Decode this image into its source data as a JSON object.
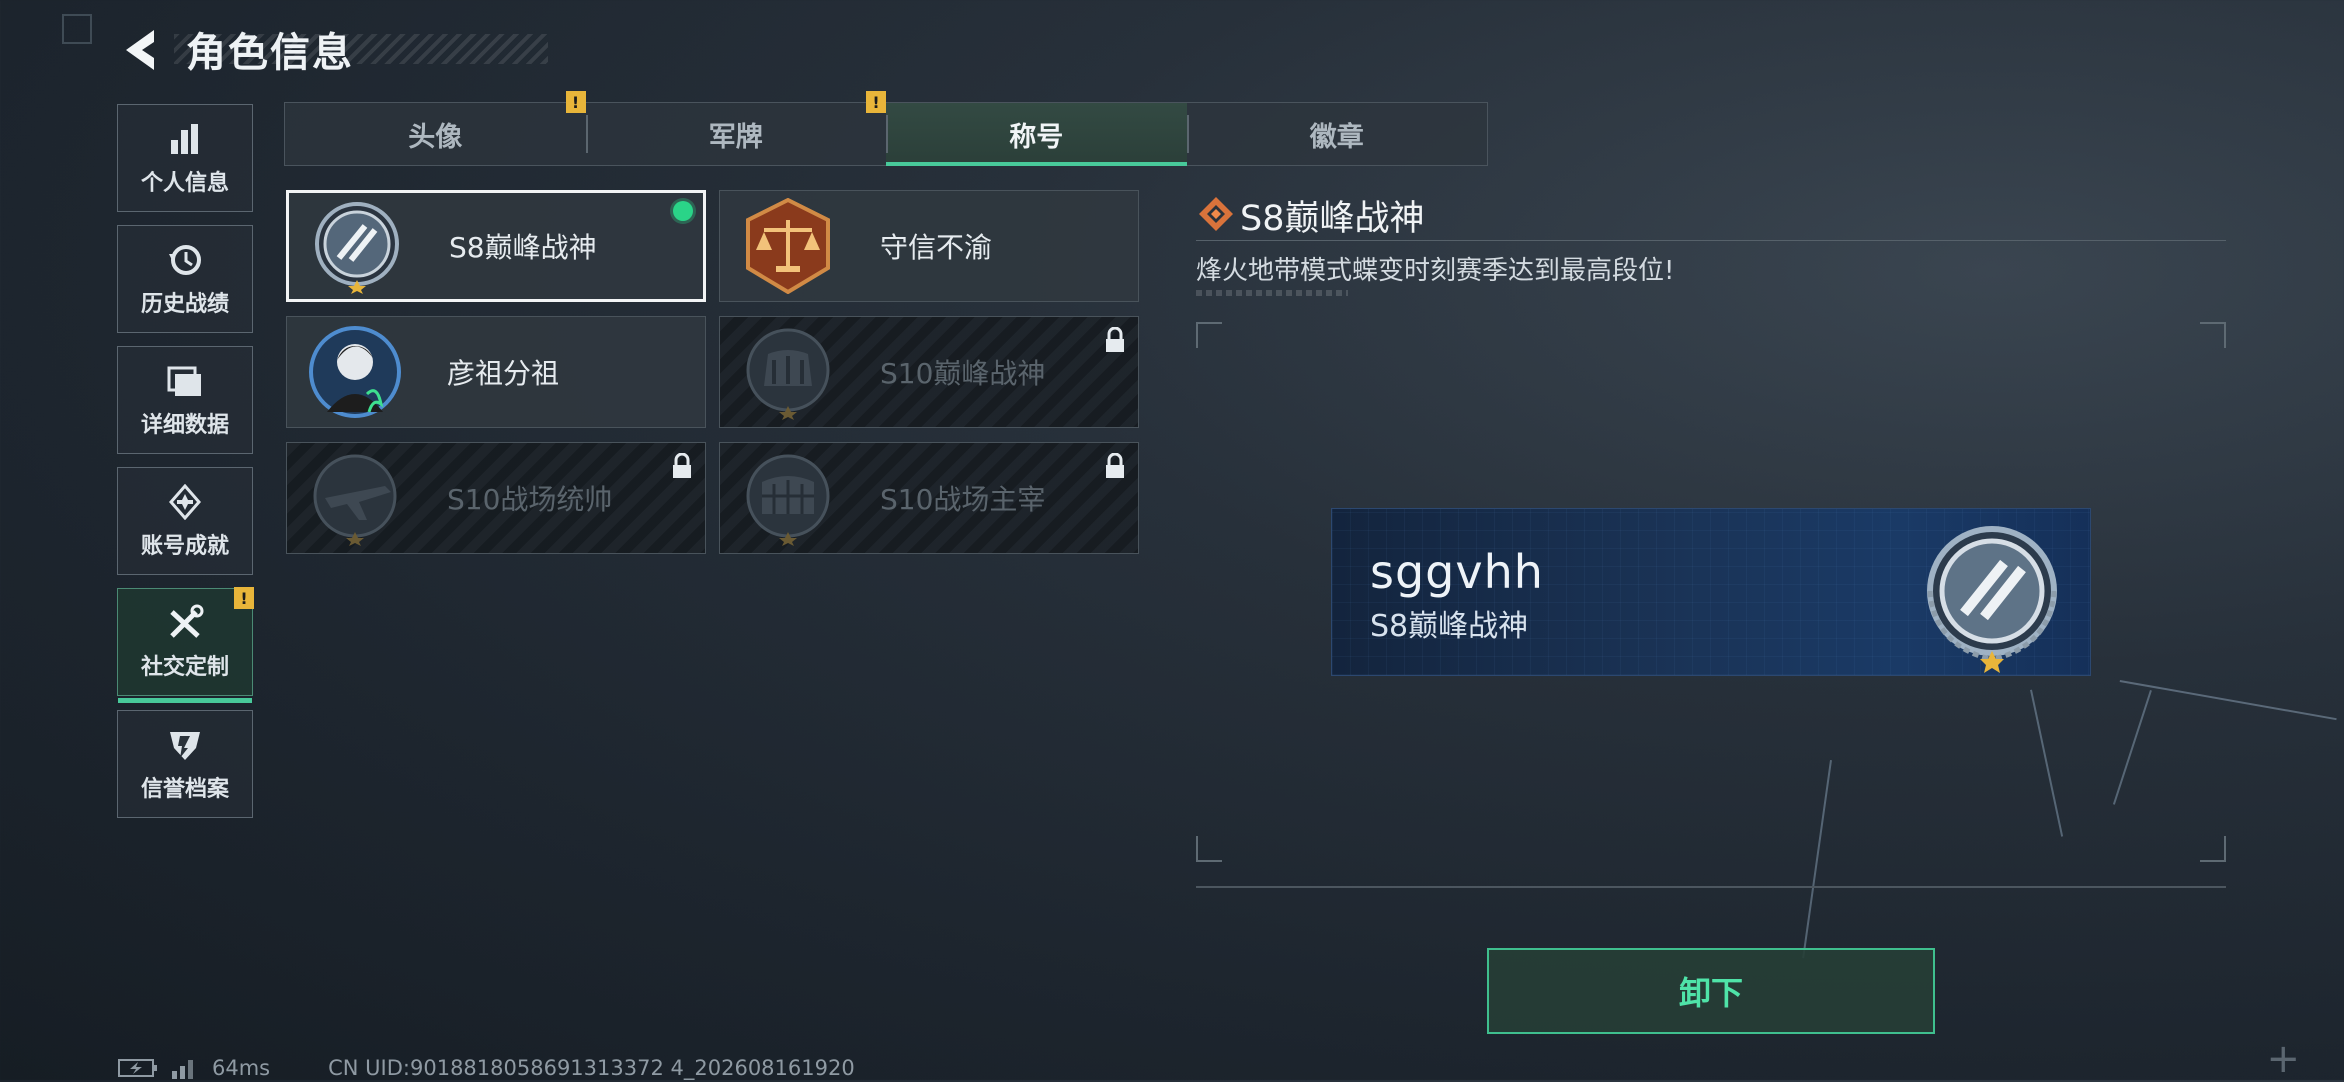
{
  "header": {
    "title": "角色信息",
    "back_icon": "back-arrow-icon"
  },
  "sidebar": {
    "items": [
      {
        "label": "个人信息",
        "icon": "bar-chart-icon",
        "active": false,
        "warning": false
      },
      {
        "label": "历史战绩",
        "icon": "history-icon",
        "active": false,
        "warning": false
      },
      {
        "label": "详细数据",
        "icon": "folder-icon",
        "active": false,
        "warning": false
      },
      {
        "label": "账号成就",
        "icon": "achievement-icon",
        "active": false,
        "warning": false
      },
      {
        "label": "社交定制",
        "icon": "tools-icon",
        "active": true,
        "warning": true
      },
      {
        "label": "信誉档案",
        "icon": "shield-icon",
        "active": false,
        "warning": false
      }
    ]
  },
  "tabs": [
    {
      "label": "头像",
      "active": false,
      "warning": true
    },
    {
      "label": "军牌",
      "active": false,
      "warning": true
    },
    {
      "label": "称号",
      "active": true,
      "warning": false
    },
    {
      "label": "徽章",
      "active": false,
      "warning": false
    }
  ],
  "warning_mark": "!",
  "titles": [
    {
      "name": "S8巅峰战神",
      "locked": false,
      "selected": true,
      "equipped": true,
      "emblem": "peak-warrior-emblem-icon"
    },
    {
      "name": "守信不渝",
      "locked": false,
      "selected": false,
      "equipped": false,
      "emblem": "scales-emblem-icon"
    },
    {
      "name": "彦祖分祖",
      "locked": false,
      "selected": false,
      "equipped": false,
      "emblem": "portrait-emblem-icon"
    },
    {
      "name": "S10巅峰战神",
      "locked": true,
      "selected": false,
      "equipped": false,
      "emblem": "colosseum-emblem-icon"
    },
    {
      "name": "S10战场统帅",
      "locked": true,
      "selected": false,
      "equipped": false,
      "emblem": "aircraft-emblem-icon"
    },
    {
      "name": "S10战场主宰",
      "locked": true,
      "selected": false,
      "equipped": false,
      "emblem": "colosseum-emblem-icon"
    }
  ],
  "detail": {
    "title": "S8巅峰战神",
    "description": "烽火地带模式蝶变时刻赛季达到最高段位!",
    "nameplate": {
      "username": "sggvhh",
      "title": "S8巅峰战神"
    },
    "action_label": "卸下"
  },
  "footer": {
    "ping": "64ms",
    "uid": "CN UID:9018818058691313372 4_202608161920"
  },
  "colors": {
    "accent": "#48c99a",
    "warning": "#e8b53a",
    "equipped_dot": "#2ad488"
  }
}
